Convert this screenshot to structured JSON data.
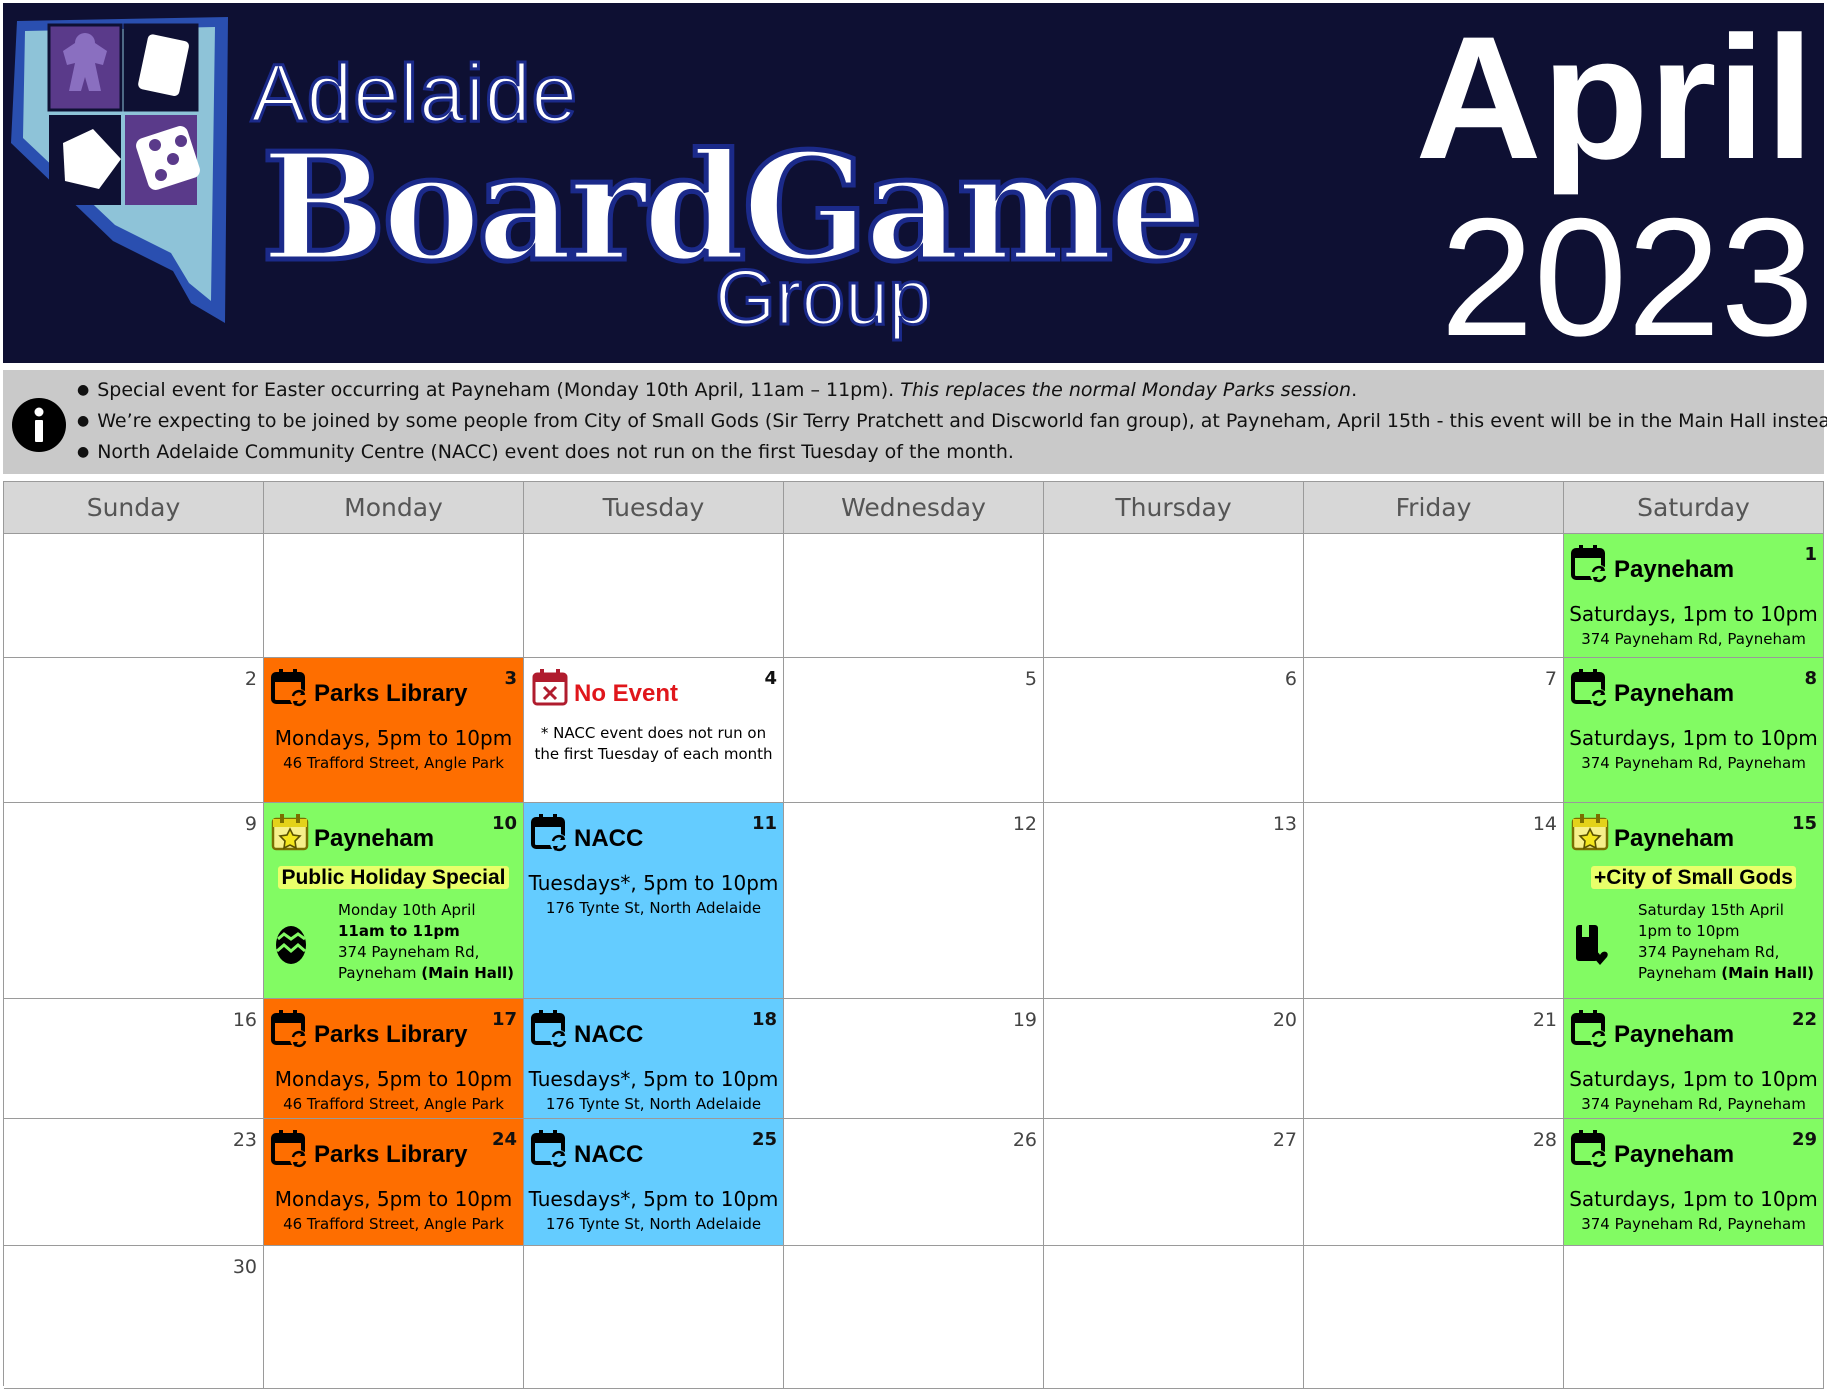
{
  "header": {
    "logo": {
      "line1": "Adelaide",
      "line2": "BoardGame",
      "line3": "Group"
    },
    "month": "April",
    "year": "2023",
    "background_color": "#0e1033"
  },
  "notice": {
    "icon": "info-icon",
    "items": [
      {
        "text": "Special event for Easter occurring at Payneham (Monday 10th April, 11am – 11pm). ",
        "emphasis": "This replaces the normal Monday Parks session",
        "tail": "."
      },
      {
        "text": "We’re expecting to be joined by some people from City of Small Gods (Sir Terry Pratchett and Discworld fan group), at Payneham, April 15th - this event will be in the Main Hall instead."
      },
      {
        "text": "North Adelaide Community Centre (NACC) event does not run on the first Tuesday of the month."
      }
    ]
  },
  "calendar": {
    "weekdays": [
      "Sunday",
      "Monday",
      "Tuesday",
      "Wednesday",
      "Thursday",
      "Friday",
      "Saturday"
    ],
    "colors": {
      "parks": "#fe6e00",
      "nacc": "#64ccff",
      "payneham": "#82fb63",
      "no_event": "#e0161b"
    },
    "events": {
      "parks": {
        "title": "Parks Library",
        "time": "Mondays, 5pm to 10pm",
        "address": "46 Trafford Street, Angle Park"
      },
      "nacc": {
        "title": "NACC",
        "time": "Tuesdays*, 5pm to 10pm",
        "address": "176 Tynte St, North Adelaide"
      },
      "payneham": {
        "title": "Payneham",
        "time": "Saturdays, 1pm to 10pm",
        "address": "374 Payneham Rd, Payneham"
      },
      "no_event": {
        "title": "No Event",
        "note": "* NACC event does not run on the first Tuesday of each month"
      },
      "easter": {
        "title": "Payneham",
        "banner": "Public Holiday Special",
        "date": "Monday 10th April",
        "time": "11am to 11pm",
        "address1": "374 Payneham Rd,",
        "address2": "Payneham",
        "hall": "(Main Hall)",
        "icon": "easter-egg-icon"
      },
      "small_gods": {
        "title": "Payneham",
        "banner": "+City of Small Gods",
        "date": "Saturday 15th April",
        "time": "1pm to 10pm",
        "address1": "374 Payneham Rd,",
        "address2": "Payneham",
        "hall": "(Main Hall)",
        "icon": "book-heart-icon"
      }
    },
    "weeks": [
      [
        null,
        null,
        null,
        null,
        null,
        null,
        {
          "day": "1",
          "event": "payneham"
        }
      ],
      [
        {
          "day": "2"
        },
        {
          "day": "3",
          "event": "parks"
        },
        {
          "day": "4",
          "event": "no_event"
        },
        {
          "day": "5"
        },
        {
          "day": "6"
        },
        {
          "day": "7"
        },
        {
          "day": "8",
          "event": "payneham"
        }
      ],
      [
        {
          "day": "9"
        },
        {
          "day": "10",
          "event": "easter"
        },
        {
          "day": "11",
          "event": "nacc"
        },
        {
          "day": "12"
        },
        {
          "day": "13"
        },
        {
          "day": "14"
        },
        {
          "day": "15",
          "event": "small_gods"
        }
      ],
      [
        {
          "day": "16"
        },
        {
          "day": "17",
          "event": "parks"
        },
        {
          "day": "18",
          "event": "nacc"
        },
        {
          "day": "19"
        },
        {
          "day": "20"
        },
        {
          "day": "21"
        },
        {
          "day": "22",
          "event": "payneham"
        }
      ],
      [
        {
          "day": "23"
        },
        {
          "day": "24",
          "event": "parks"
        },
        {
          "day": "25",
          "event": "nacc"
        },
        {
          "day": "26"
        },
        {
          "day": "27"
        },
        {
          "day": "28"
        },
        {
          "day": "29",
          "event": "payneham"
        }
      ],
      [
        {
          "day": "30"
        },
        null,
        null,
        null,
        null,
        null,
        null
      ]
    ]
  }
}
